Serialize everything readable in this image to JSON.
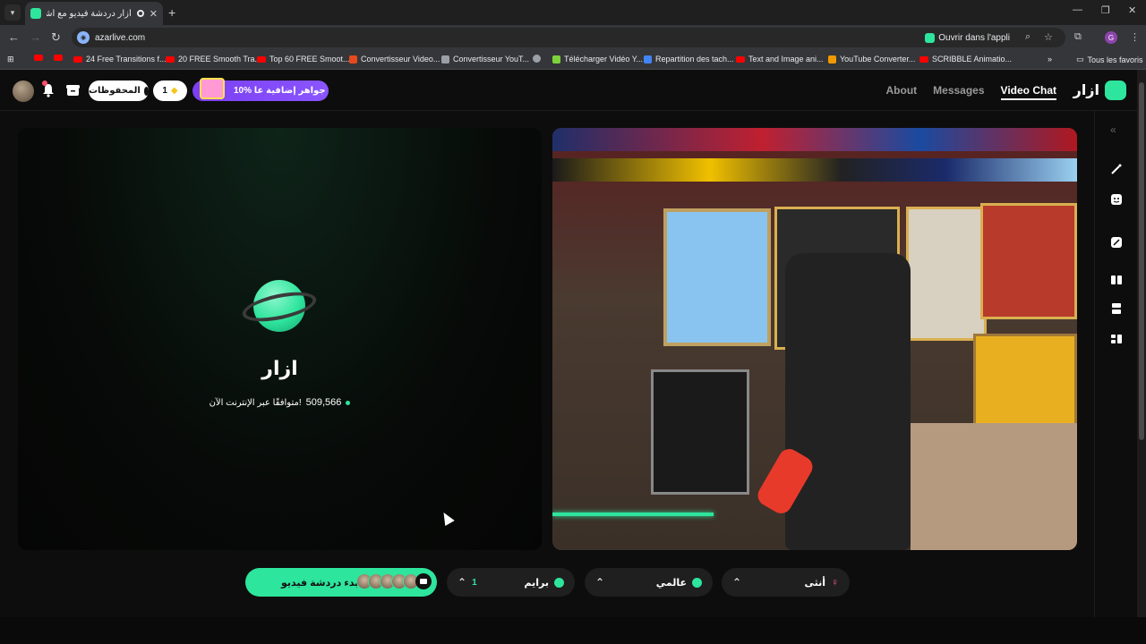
{
  "browser": {
    "tab_title": "أزار دردشة فيديو مع أشخاص",
    "url": "azarlive.com",
    "open_in_app": "Ouvrir dans l'appli",
    "all_bookmarks": "Tous les favoris",
    "bookmarks": [
      {
        "label": ""
      },
      {
        "label": ""
      },
      {
        "label": "24 Free Transitions f..."
      },
      {
        "label": "20 FREE Smooth Tra..."
      },
      {
        "label": "Top 60 FREE Smoot..."
      },
      {
        "label": "Convertisseur Video..."
      },
      {
        "label": "Convertisseur YouT..."
      },
      {
        "label": ""
      },
      {
        "label": "Télécharger Vidéo Y..."
      },
      {
        "label": "Repartition des tach..."
      },
      {
        "label": "Text and Image ani..."
      },
      {
        "label": "YouTube Converter..."
      },
      {
        "label": "SCRIBBLE Animatio..."
      }
    ]
  },
  "header": {
    "saved_label": "المحفوظات",
    "gems_count": "1",
    "promo_label": "10% جواهر إضافية عا",
    "nav": {
      "about": "About",
      "messages": "Messages",
      "video_chat": "Video Chat"
    },
    "brand": "ازار"
  },
  "left_panel": {
    "brand": "ازار",
    "online_count": "509,566",
    "online_text": "متوافقًا عبر الإنترنت الآن!"
  },
  "bottom": {
    "start_label": "بدء دردشة فيديو",
    "gender_filter": "أنثى",
    "region_filter": "عالمي",
    "vip_filter": "برايم",
    "vip_count": "1"
  },
  "colors": {
    "accent": "#2ee59d",
    "promo": "#7b3ff2",
    "background": "#0d0d0d"
  }
}
